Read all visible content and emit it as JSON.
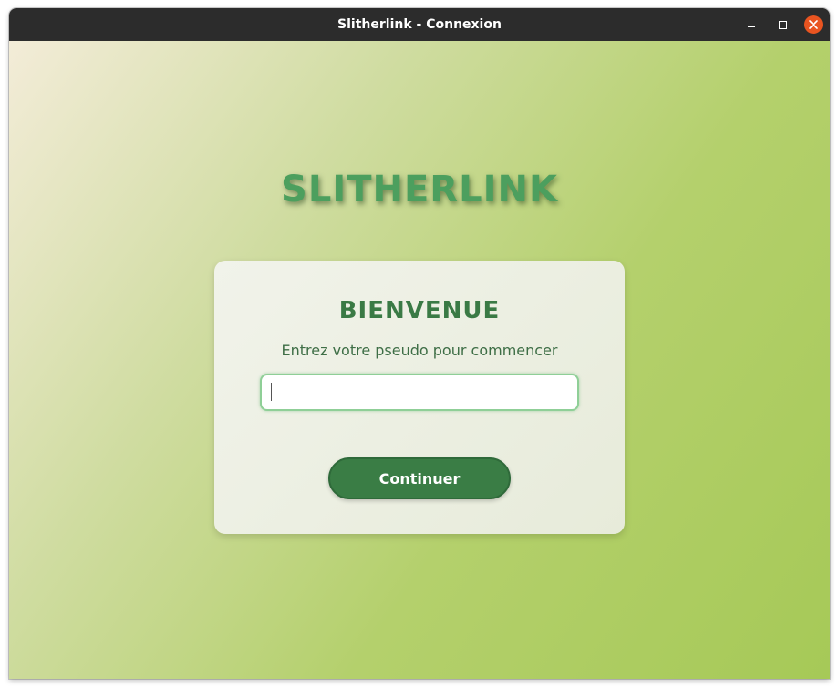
{
  "window": {
    "title": "Slitherlink - Connexion",
    "controls": {
      "minimize_icon": "minimize-icon",
      "maximize_icon": "maximize-icon",
      "close_icon": "close-icon",
      "close_color": "#e95420"
    }
  },
  "app": {
    "title": "SLITHERLINK"
  },
  "login": {
    "heading": "BIENVENUE",
    "subtitle": "Entrez votre pseudo pour commencer",
    "pseudo_value": "",
    "continue_label": "Continuer"
  },
  "colors": {
    "title_green": "#4c9f5e",
    "heading_green": "#3a7a45",
    "button_green": "#3a7d45",
    "input_border": "#8fcf97",
    "titlebar": "#2c2c2c"
  }
}
